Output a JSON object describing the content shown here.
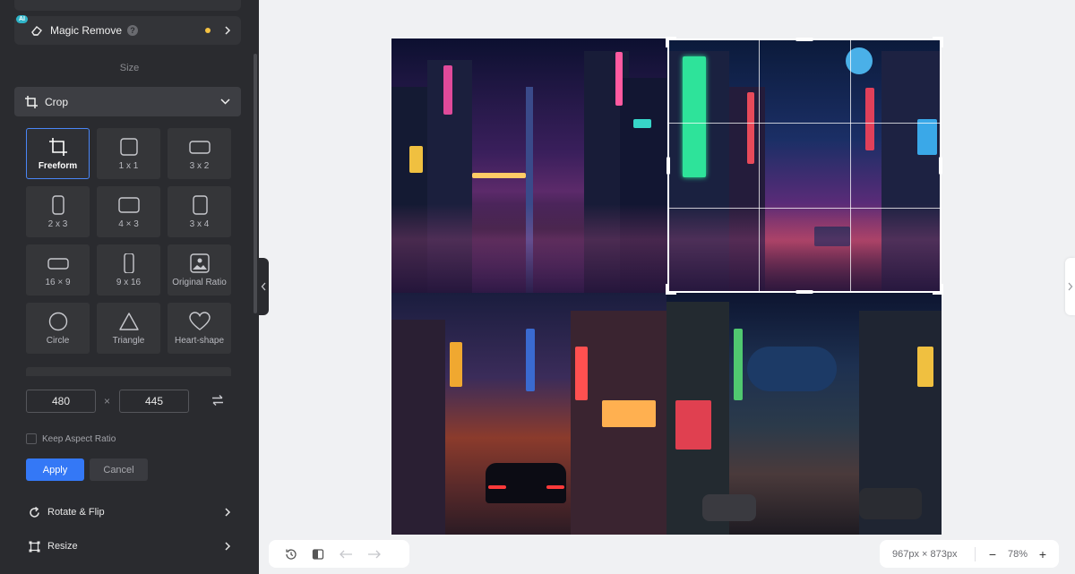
{
  "sidebar": {
    "magic_remove": {
      "label": "Magic Remove",
      "badge": "AI",
      "help": "?"
    },
    "size_section_label": "Size",
    "crop": {
      "label": "Crop",
      "presets": [
        {
          "label": "Freeform",
          "icon": "freeform-crop-icon",
          "selected": true
        },
        {
          "label": "1 x 1",
          "icon": "square-icon"
        },
        {
          "label": "3 x 2",
          "icon": "landscape-rect-icon"
        },
        {
          "label": "2 x 3",
          "icon": "portrait-rect-icon"
        },
        {
          "label": "4 × 3",
          "icon": "landscape-rect-icon"
        },
        {
          "label": "3 x 4",
          "icon": "portrait-rect-icon"
        },
        {
          "label": "16 × 9",
          "icon": "wide-rect-icon"
        },
        {
          "label": "9 x 16",
          "icon": "tall-rect-icon"
        },
        {
          "label": "Original Ratio",
          "icon": "image-icon"
        },
        {
          "label": "Circle",
          "icon": "circle-icon"
        },
        {
          "label": "Triangle",
          "icon": "triangle-icon"
        },
        {
          "label": "Heart-shape",
          "icon": "heart-icon"
        }
      ],
      "width_value": "480",
      "height_value": "445",
      "times": "×",
      "keep_aspect_label": "Keep Aspect Ratio",
      "keep_aspect_checked": false,
      "apply_label": "Apply",
      "cancel_label": "Cancel"
    },
    "rotate_flip_label": "Rotate & Flip",
    "resize_label": "Resize"
  },
  "canvas": {
    "image_size": "967px × 873px",
    "zoom": "78%",
    "zoom_out": "−",
    "zoom_in": "+"
  },
  "colors": {
    "sidebar_bg": "#2a2b2f",
    "accent": "#3478f6",
    "selected_border": "#4a86f7",
    "canvas_bg": "#f0f1f3"
  }
}
